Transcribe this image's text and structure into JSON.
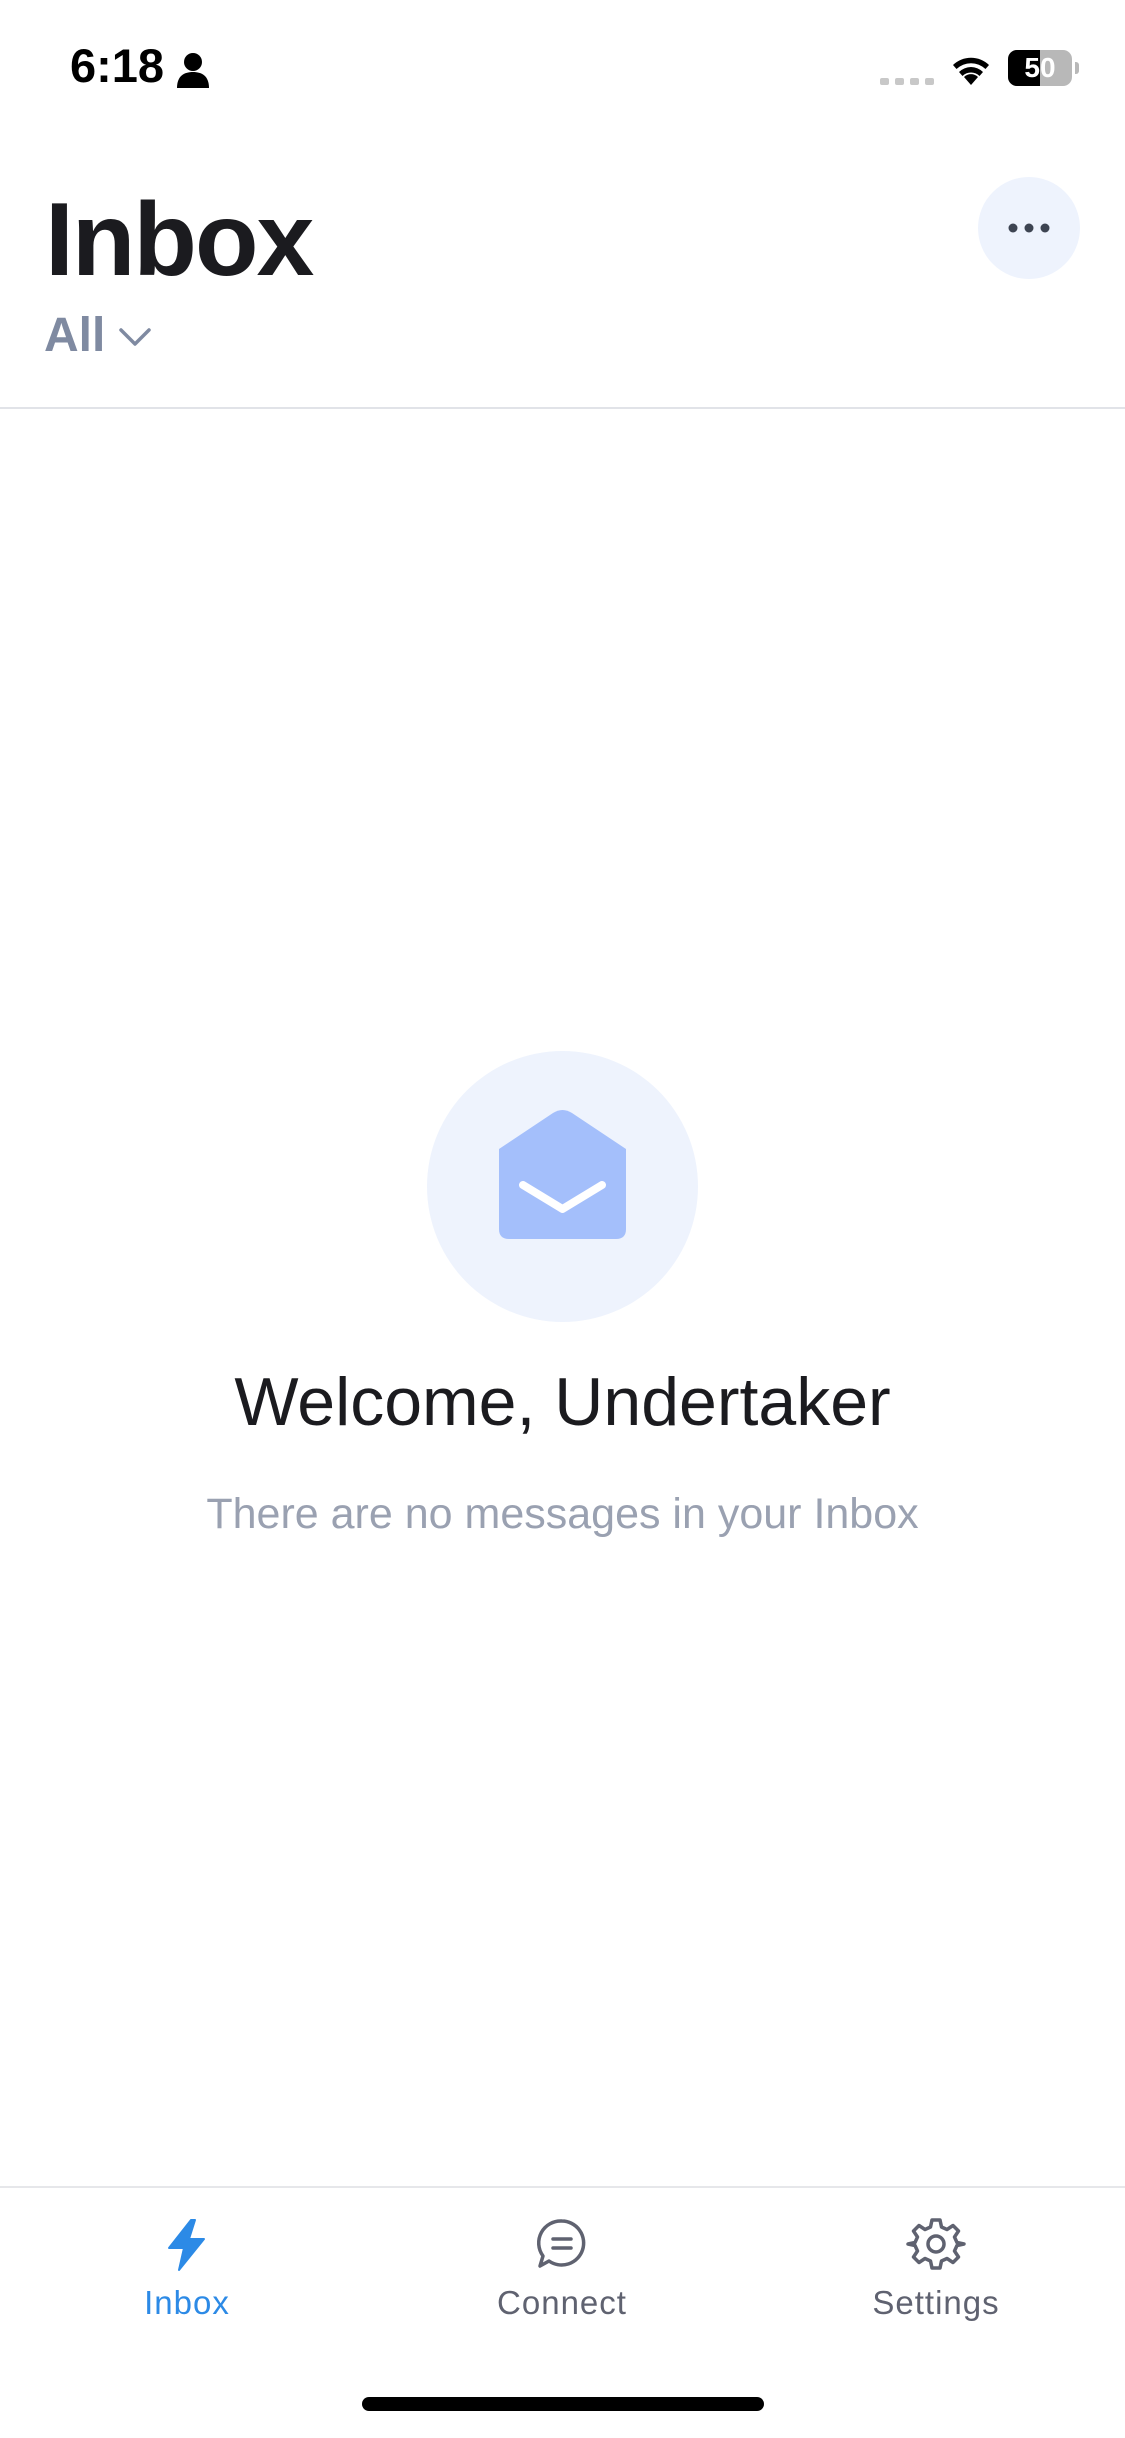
{
  "status_bar": {
    "time": "6:18",
    "battery_level": "50",
    "battery_fraction": 0.5,
    "icons": [
      "person-icon",
      "signal-icon",
      "wifi-icon",
      "battery-icon"
    ]
  },
  "header": {
    "title": "Inbox",
    "filter_label": "All",
    "more_icon": "ellipsis-icon"
  },
  "empty_state": {
    "icon": "open-envelope-icon",
    "title": "Welcome, Undertaker",
    "subtitle": "There are no messages in your Inbox"
  },
  "tab_bar": {
    "tabs": [
      {
        "label": "Inbox",
        "icon": "bolt-icon",
        "active": true
      },
      {
        "label": "Connect",
        "icon": "chat-bubble-icon",
        "active": false
      },
      {
        "label": "Settings",
        "icon": "gear-icon",
        "active": false
      }
    ]
  },
  "colors": {
    "accent": "#2c8ae6",
    "illustration_bg": "#eef3fd",
    "illustration_fg": "#a4bffb",
    "muted_text": "#9aa1b1",
    "filter_text": "#7f8aa1"
  }
}
